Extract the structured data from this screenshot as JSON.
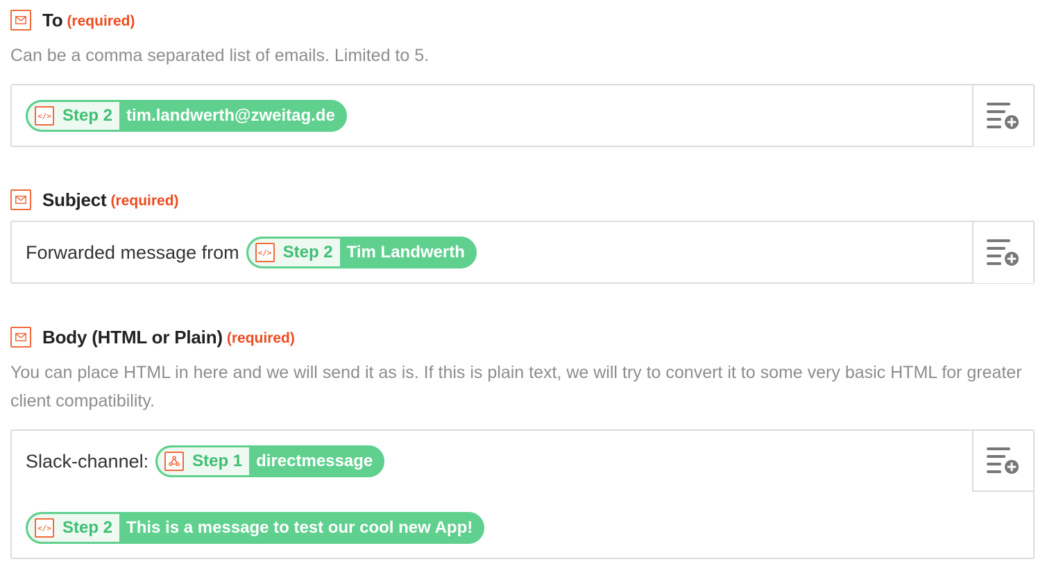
{
  "fields": {
    "to": {
      "label": "To",
      "required": "(required)",
      "help": "Can be a comma separated list of emails. Limited to 5.",
      "pill": {
        "step": "Step 2",
        "value": "tim.landwerth@zweitag.de",
        "icon": "code-icon"
      }
    },
    "subject": {
      "label": "Subject",
      "required": "(required)",
      "prefix": "Forwarded message from",
      "pill": {
        "step": "Step 2",
        "value": "Tim Landwerth",
        "icon": "code-icon"
      }
    },
    "body": {
      "label": "Body (HTML or Plain)",
      "required": "(required)",
      "help": "You can place HTML in here and we will send it as is. If this is plain text, we will try to convert it to some very basic HTML for greater client compatibility.",
      "prefix": "Slack-channel:",
      "pill1": {
        "step": "Step 1",
        "value": "directmessage",
        "icon": "webhook-icon"
      },
      "pill2": {
        "step": "Step 2",
        "value": "This is a message to test our cool new App!",
        "icon": "code-icon"
      }
    }
  },
  "icons": {
    "field_icon": "envelope-icon",
    "insert_button_icon": "list-add-icon"
  },
  "colors": {
    "accent_orange": "#f06a3b",
    "required_red": "#ee4b1f",
    "pill_green": "#5fd08e",
    "pill_step_text": "#3fbf73",
    "help_gray": "#8d8d8d",
    "border_gray": "#dcdcdc"
  }
}
